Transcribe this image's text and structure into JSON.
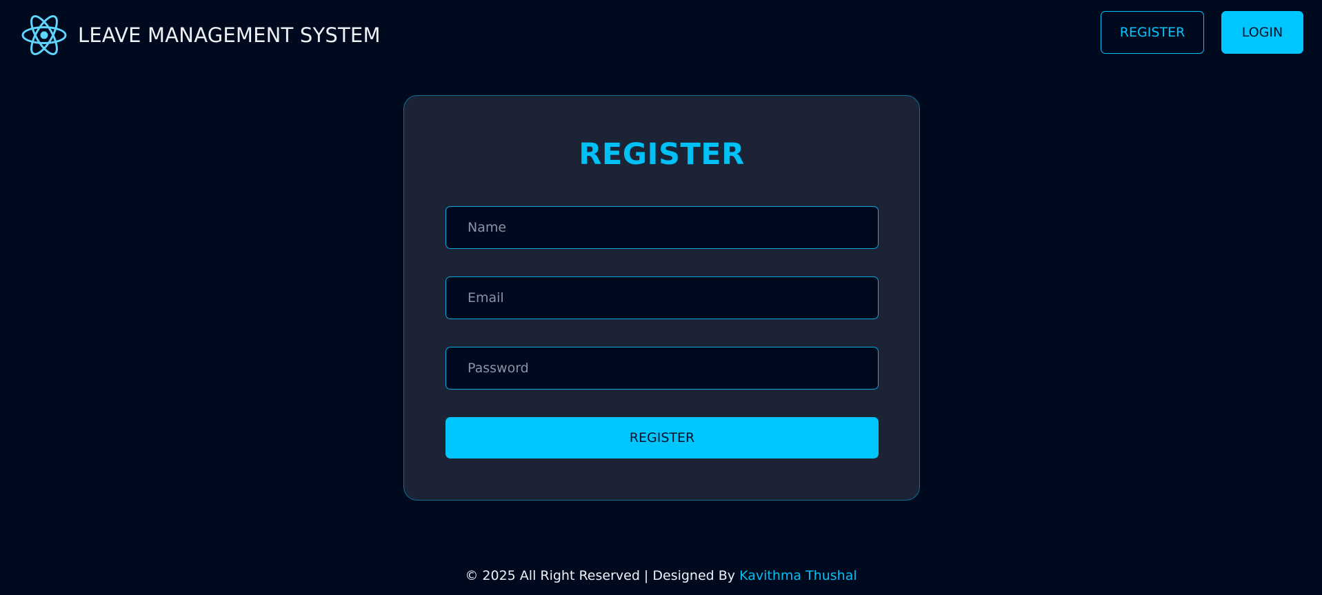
{
  "header": {
    "logo_icon": "atom-icon",
    "title": "LEAVE MANAGEMENT SYSTEM",
    "register_label": "REGISTER",
    "login_label": "LOGIN"
  },
  "form": {
    "title": "REGISTER",
    "name_placeholder": "Name",
    "email_placeholder": "Email",
    "password_placeholder": "Password",
    "submit_label": "REGISTER"
  },
  "footer": {
    "text": "© 2025 All Right Reserved | Designed By",
    "author": "Kavithma Thushal"
  },
  "colors": {
    "background": "#000a1f",
    "accent": "#00c6ff",
    "card": "#1b2335"
  }
}
